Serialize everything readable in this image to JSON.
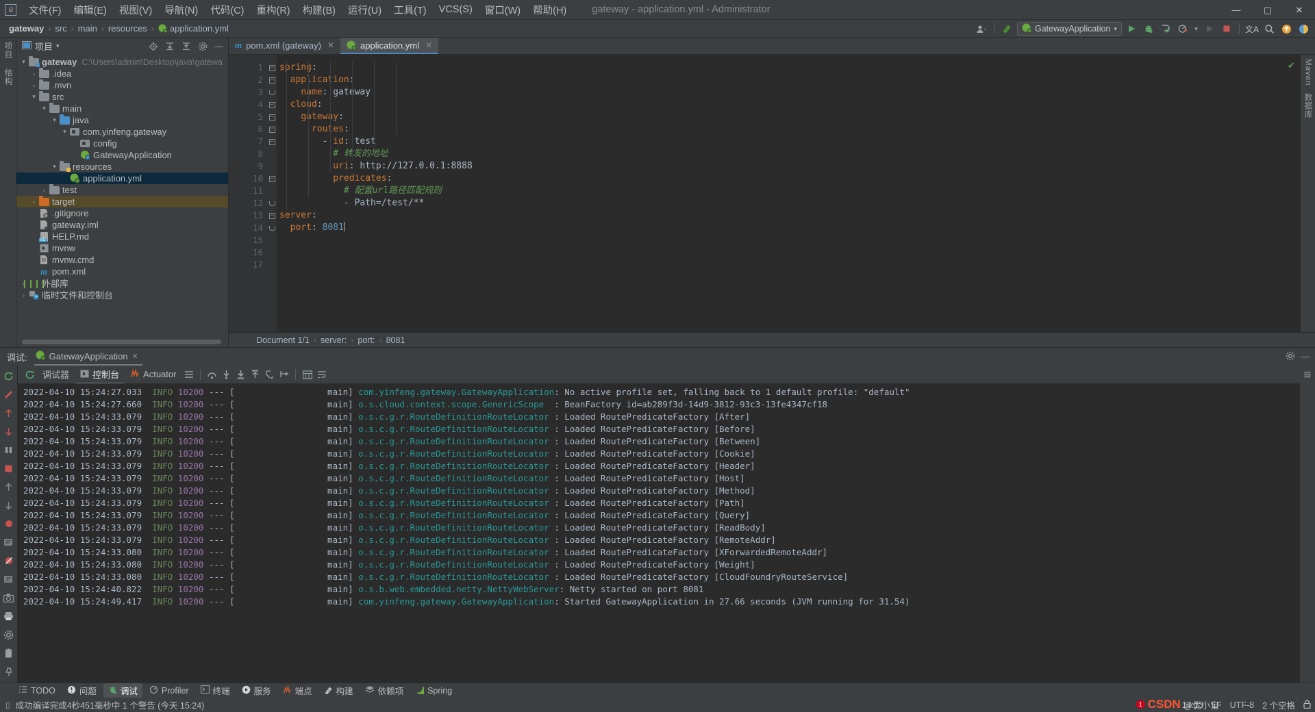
{
  "titlebar": {
    "logo": "IJ",
    "menus": [
      "文件(F)",
      "编辑(E)",
      "视图(V)",
      "导航(N)",
      "代码(C)",
      "重构(R)",
      "构建(B)",
      "运行(U)",
      "工具(T)",
      "VCS(S)",
      "窗口(W)",
      "帮助(H)"
    ],
    "window_title": "gateway - application.yml - Administrator",
    "minimize": "—",
    "maximize": "▢",
    "close": "✕"
  },
  "navbar": {
    "breadcrumb": [
      "gateway",
      "src",
      "main",
      "resources",
      "application.yml"
    ],
    "separator": "›",
    "toolbar": {
      "user_icon": "user-icon",
      "update_icon": "update-icon",
      "run_config": "GatewayApplication",
      "dropdown": "▾",
      "run": "▶",
      "debug": "debug-icon",
      "run_coverage": "coverage-icon",
      "profile": "profile-icon",
      "rerun": "▶",
      "stop": "■",
      "translate": "文A",
      "search": "search-icon",
      "up": "↑",
      "theme": "theme-icon"
    }
  },
  "left_rail": [
    "项目",
    "结构"
  ],
  "project_panel": {
    "title": "项目",
    "dropdown": "▾",
    "actions": [
      "locate-icon",
      "expand-all-icon",
      "collapse-all-icon",
      "settings-icon",
      "hide-icon"
    ],
    "tree": [
      {
        "label": "gateway",
        "path": "C:\\Users\\admin\\Desktop\\java\\gatewa",
        "indent": 0,
        "arrow": "▾",
        "icon": "module-folder",
        "bold": true
      },
      {
        "label": ".idea",
        "indent": 1,
        "arrow": "›",
        "icon": "folder-grey"
      },
      {
        "label": ".mvn",
        "indent": 1,
        "arrow": "›",
        "icon": "folder-grey"
      },
      {
        "label": "src",
        "indent": 1,
        "arrow": "▾",
        "icon": "folder-grey"
      },
      {
        "label": "main",
        "indent": 2,
        "arrow": "▾",
        "icon": "folder-grey"
      },
      {
        "label": "java",
        "indent": 3,
        "arrow": "▾",
        "icon": "folder-blue-source"
      },
      {
        "label": "com.yinfeng.gateway",
        "indent": 4,
        "arrow": "▾",
        "icon": "package"
      },
      {
        "label": "config",
        "indent": 5,
        "arrow": "",
        "icon": "package"
      },
      {
        "label": "GatewayApplication",
        "indent": 5,
        "arrow": "",
        "icon": "spring-class"
      },
      {
        "label": "resources",
        "indent": 3,
        "arrow": "▾",
        "icon": "folder-resources"
      },
      {
        "label": "application.yml",
        "indent": 4,
        "arrow": "",
        "icon": "spring-leaf",
        "selected": true
      },
      {
        "label": "test",
        "indent": 2,
        "arrow": "›",
        "icon": "folder-grey"
      },
      {
        "label": "target",
        "indent": 1,
        "arrow": "›",
        "icon": "folder-orange",
        "highlight": true
      },
      {
        "label": ".gitignore",
        "indent": 1,
        "arrow": "",
        "icon": "gitignore-file"
      },
      {
        "label": "gateway.iml",
        "indent": 1,
        "arrow": "",
        "icon": "iml-file"
      },
      {
        "label": "HELP.md",
        "indent": 1,
        "arrow": "",
        "icon": "md-file"
      },
      {
        "label": "mvnw",
        "indent": 1,
        "arrow": "",
        "icon": "script-file"
      },
      {
        "label": "mvnw.cmd",
        "indent": 1,
        "arrow": "",
        "icon": "cmd-file"
      },
      {
        "label": "pom.xml",
        "indent": 1,
        "arrow": "",
        "icon": "maven-file"
      },
      {
        "label": "外部库",
        "indent": 0,
        "arrow": "›",
        "icon": "libraries-icon"
      },
      {
        "label": "临时文件和控制台",
        "indent": 0,
        "arrow": "›",
        "icon": "scratches-icon"
      }
    ]
  },
  "editor": {
    "tabs": [
      {
        "label": "pom.xml (gateway)",
        "icon": "maven-file",
        "active": false,
        "close": "✕"
      },
      {
        "label": "application.yml",
        "icon": "spring-leaf",
        "active": true,
        "close": "✕"
      }
    ],
    "lines": [
      {
        "n": 1,
        "fold": "minus",
        "indent": 0,
        "tokens": [
          {
            "t": "spring",
            "c": "k"
          },
          {
            "t": ":",
            "c": "v"
          }
        ]
      },
      {
        "n": 2,
        "fold": "minus",
        "indent": 1,
        "tokens": [
          {
            "t": "application",
            "c": "k"
          },
          {
            "t": ":",
            "c": "v"
          }
        ]
      },
      {
        "n": 3,
        "fold": "end",
        "indent": 2,
        "tokens": [
          {
            "t": "name",
            "c": "k"
          },
          {
            "t": ": ",
            "c": "v"
          },
          {
            "t": "gateway",
            "c": "v"
          }
        ]
      },
      {
        "n": 4,
        "fold": "minus",
        "indent": 1,
        "tokens": [
          {
            "t": "cloud",
            "c": "k"
          },
          {
            "t": ":",
            "c": "v"
          }
        ]
      },
      {
        "n": 5,
        "fold": "minus",
        "indent": 2,
        "tokens": [
          {
            "t": "gateway",
            "c": "k"
          },
          {
            "t": ":",
            "c": "v"
          }
        ]
      },
      {
        "n": 6,
        "fold": "minus",
        "indent": 3,
        "tokens": [
          {
            "t": "routes",
            "c": "k"
          },
          {
            "t": ":",
            "c": "v"
          }
        ]
      },
      {
        "n": 7,
        "fold": "minus",
        "indent": 4,
        "tokens": [
          {
            "t": "- ",
            "c": "v"
          },
          {
            "t": "id",
            "c": "k"
          },
          {
            "t": ": ",
            "c": "v"
          },
          {
            "t": "test",
            "c": "v"
          }
        ]
      },
      {
        "n": 8,
        "fold": "",
        "indent": 5,
        "tokens": [
          {
            "t": "# 转发的地址",
            "c": "cm"
          }
        ]
      },
      {
        "n": 9,
        "fold": "",
        "indent": 5,
        "tokens": [
          {
            "t": "uri",
            "c": "k"
          },
          {
            "t": ": ",
            "c": "v"
          },
          {
            "t": "http://127.0.0.1:8888",
            "c": "v"
          }
        ]
      },
      {
        "n": 10,
        "fold": "minus",
        "indent": 5,
        "tokens": [
          {
            "t": "predicates",
            "c": "k"
          },
          {
            "t": ":",
            "c": "v"
          }
        ]
      },
      {
        "n": 11,
        "fold": "",
        "indent": 6,
        "tokens": [
          {
            "t": "# 配置url路径匹配规则",
            "c": "cm"
          }
        ]
      },
      {
        "n": 12,
        "fold": "end",
        "indent": 6,
        "tokens": [
          {
            "t": "- Path=/test/**",
            "c": "v"
          }
        ]
      },
      {
        "n": 13,
        "fold": "minus",
        "indent": 0,
        "tokens": [
          {
            "t": "server",
            "c": "k"
          },
          {
            "t": ":",
            "c": "v"
          }
        ]
      },
      {
        "n": 14,
        "fold": "end",
        "indent": 1,
        "tokens": [
          {
            "t": "port",
            "c": "k"
          },
          {
            "t": ": ",
            "c": "v"
          },
          {
            "t": "8081",
            "c": "num"
          }
        ],
        "caret": true
      },
      {
        "n": 15,
        "fold": "",
        "indent": 0,
        "tokens": []
      },
      {
        "n": 16,
        "fold": "",
        "indent": 0,
        "tokens": []
      },
      {
        "n": 17,
        "fold": "",
        "indent": 0,
        "tokens": []
      }
    ],
    "inspection_status": "✔",
    "breadcrumb_bar": [
      "Document 1/1",
      "server:",
      "port:",
      "8081"
    ],
    "breadcrumb_sep": "›",
    "right_rail": [
      "Maven",
      "数据库"
    ]
  },
  "debug_panel": {
    "label": "调试:",
    "session_tab": "GatewayApplication",
    "session_close": "✕",
    "header_right": [
      "settings-icon",
      "hide-icon"
    ],
    "tabs": [
      {
        "label": "调试器",
        "icon": "",
        "active": false
      },
      {
        "label": "控制台",
        "icon": "console-icon",
        "active": true
      },
      {
        "label": "Actuator",
        "icon": "actuator-icon",
        "active": false
      }
    ],
    "tab_icons": [
      "layout-icon",
      "step-over-icon",
      "step-into-icon",
      "force-step-into-icon",
      "step-out-icon",
      "drop-frame-icon",
      "run-to-cursor-icon",
      "evaluate-icon",
      "soft-wrap-icon"
    ],
    "rail_icons": [
      "rerun-icon",
      "edit-config-icon",
      "up-icon",
      "down-icon",
      "pause-icon",
      "stop-icon",
      "up2-icon",
      "down2-icon",
      "mute-breakpoints-icon",
      "view-breakpoints-icon",
      "no-breakpoints-icon",
      "settings2-icon",
      "camera-icon",
      "print-icon",
      "gear-icon",
      "trash-icon",
      "pin-icon"
    ],
    "console_lines": [
      {
        "time": "2022-04-10 15:24:27.033",
        "level": "INFO",
        "pid": "10200",
        "thread": "main",
        "cls": "com.yinfeng.gateway.GatewayApplication",
        "msg": "No active profile set, falling back to 1 default profile: \"default\""
      },
      {
        "time": "2022-04-10 15:24:27.660",
        "level": "INFO",
        "pid": "10200",
        "thread": "main",
        "cls": "o.s.cloud.context.scope.GenericScope",
        "msg": "BeanFactory id=ab289f3d-14d9-3812-93c3-13fe4347cf18"
      },
      {
        "time": "2022-04-10 15:24:33.079",
        "level": "INFO",
        "pid": "10200",
        "thread": "main",
        "cls": "o.s.c.g.r.RouteDefinitionRouteLocator",
        "msg": "Loaded RoutePredicateFactory [After]"
      },
      {
        "time": "2022-04-10 15:24:33.079",
        "level": "INFO",
        "pid": "10200",
        "thread": "main",
        "cls": "o.s.c.g.r.RouteDefinitionRouteLocator",
        "msg": "Loaded RoutePredicateFactory [Before]"
      },
      {
        "time": "2022-04-10 15:24:33.079",
        "level": "INFO",
        "pid": "10200",
        "thread": "main",
        "cls": "o.s.c.g.r.RouteDefinitionRouteLocator",
        "msg": "Loaded RoutePredicateFactory [Between]"
      },
      {
        "time": "2022-04-10 15:24:33.079",
        "level": "INFO",
        "pid": "10200",
        "thread": "main",
        "cls": "o.s.c.g.r.RouteDefinitionRouteLocator",
        "msg": "Loaded RoutePredicateFactory [Cookie]"
      },
      {
        "time": "2022-04-10 15:24:33.079",
        "level": "INFO",
        "pid": "10200",
        "thread": "main",
        "cls": "o.s.c.g.r.RouteDefinitionRouteLocator",
        "msg": "Loaded RoutePredicateFactory [Header]"
      },
      {
        "time": "2022-04-10 15:24:33.079",
        "level": "INFO",
        "pid": "10200",
        "thread": "main",
        "cls": "o.s.c.g.r.RouteDefinitionRouteLocator",
        "msg": "Loaded RoutePredicateFactory [Host]"
      },
      {
        "time": "2022-04-10 15:24:33.079",
        "level": "INFO",
        "pid": "10200",
        "thread": "main",
        "cls": "o.s.c.g.r.RouteDefinitionRouteLocator",
        "msg": "Loaded RoutePredicateFactory [Method]"
      },
      {
        "time": "2022-04-10 15:24:33.079",
        "level": "INFO",
        "pid": "10200",
        "thread": "main",
        "cls": "o.s.c.g.r.RouteDefinitionRouteLocator",
        "msg": "Loaded RoutePredicateFactory [Path]"
      },
      {
        "time": "2022-04-10 15:24:33.079",
        "level": "INFO",
        "pid": "10200",
        "thread": "main",
        "cls": "o.s.c.g.r.RouteDefinitionRouteLocator",
        "msg": "Loaded RoutePredicateFactory [Query]"
      },
      {
        "time": "2022-04-10 15:24:33.079",
        "level": "INFO",
        "pid": "10200",
        "thread": "main",
        "cls": "o.s.c.g.r.RouteDefinitionRouteLocator",
        "msg": "Loaded RoutePredicateFactory [ReadBody]"
      },
      {
        "time": "2022-04-10 15:24:33.079",
        "level": "INFO",
        "pid": "10200",
        "thread": "main",
        "cls": "o.s.c.g.r.RouteDefinitionRouteLocator",
        "msg": "Loaded RoutePredicateFactory [RemoteAddr]"
      },
      {
        "time": "2022-04-10 15:24:33.080",
        "level": "INFO",
        "pid": "10200",
        "thread": "main",
        "cls": "o.s.c.g.r.RouteDefinitionRouteLocator",
        "msg": "Loaded RoutePredicateFactory [XForwardedRemoteAddr]"
      },
      {
        "time": "2022-04-10 15:24:33.080",
        "level": "INFO",
        "pid": "10200",
        "thread": "main",
        "cls": "o.s.c.g.r.RouteDefinitionRouteLocator",
        "msg": "Loaded RoutePredicateFactory [Weight]"
      },
      {
        "time": "2022-04-10 15:24:33.080",
        "level": "INFO",
        "pid": "10200",
        "thread": "main",
        "cls": "o.s.c.g.r.RouteDefinitionRouteLocator",
        "msg": "Loaded RoutePredicateFactory [CloudFoundryRouteService]"
      },
      {
        "time": "2022-04-10 15:24:40.822",
        "level": "INFO",
        "pid": "10200",
        "thread": "main",
        "cls": "o.s.b.web.embedded.netty.NettyWebServer",
        "msg": "Netty started on port 8081"
      },
      {
        "time": "2022-04-10 15:24:49.417",
        "level": "INFO",
        "pid": "10200",
        "thread": "main",
        "cls": "com.yinfeng.gateway.GatewayApplication",
        "msg": "Started GatewayApplication in 27.66 seconds (JVM running for 31.54)"
      }
    ]
  },
  "toolwindow_bar": [
    {
      "label": "TODO",
      "icon": "todo-icon",
      "active": false
    },
    {
      "label": "问题",
      "icon": "problems-icon",
      "active": false
    },
    {
      "label": "调试",
      "icon": "debug-icon",
      "active": true
    },
    {
      "label": "Profiler",
      "icon": "profiler-icon",
      "active": false
    },
    {
      "label": "终端",
      "icon": "terminal-icon",
      "active": false
    },
    {
      "label": "服务",
      "icon": "services-icon",
      "active": false
    },
    {
      "label": "端点",
      "icon": "endpoints-icon",
      "active": false
    },
    {
      "label": "构建",
      "icon": "build-icon",
      "active": false
    },
    {
      "label": "依赖项",
      "icon": "dependencies-icon",
      "active": false
    },
    {
      "label": "Spring",
      "icon": "spring-icon",
      "active": false
    }
  ],
  "statusbar": {
    "icon": "message-icon",
    "message": "成功编译完成4秒451毫秒中 1 个警告 (今天 15:24)",
    "time": "14:13",
    "line_sep": "LF",
    "encoding": "UTF-8",
    "indent": "2 个空格",
    "lock": "lock-icon",
    "csdn_logo": "CSDN",
    "csdn_text": "@优小宝",
    "badge": "1"
  },
  "colors": {
    "bg": "#3c3f41",
    "editor_bg": "#2b2b2b",
    "accent_blue": "#4a88c7",
    "keyword": "#cc7832",
    "number": "#6897bb",
    "comment": "#629755",
    "selection": "#0d293e",
    "target_highlight": "#554b2b",
    "log_class": "#299999",
    "log_info": "#6a8759",
    "log_pid": "#9876aa"
  }
}
